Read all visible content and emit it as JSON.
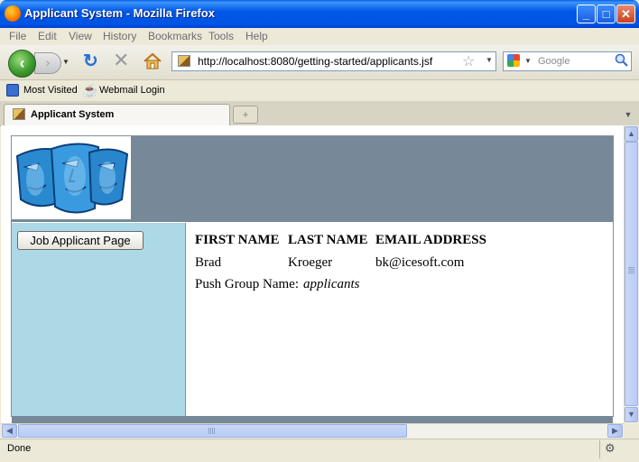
{
  "window": {
    "title": "Applicant System - Mozilla Firefox"
  },
  "menu": [
    "File",
    "Edit",
    "View",
    "History",
    "Bookmarks",
    "Tools",
    "Help"
  ],
  "nav": {
    "url": "http://localhost:8080/getting-started/applicants.jsf",
    "search_placeholder": "Google"
  },
  "bookmarks": [
    {
      "label": "Most Visited"
    },
    {
      "label": "Webmail Login"
    }
  ],
  "tabs": [
    {
      "label": "Applicant System"
    }
  ],
  "page": {
    "job_button_label": "Job Applicant Page",
    "headers": [
      "FIRST NAME",
      "LAST NAME",
      "EMAIL ADDRESS"
    ],
    "row": {
      "first": "Brad",
      "last": "Kroeger",
      "email": "bk@icesoft.com"
    },
    "push_group_label": "Push Group Name:",
    "push_group_value": "applicants"
  },
  "status": {
    "text": "Done"
  },
  "colors": {
    "header_band": "#778899",
    "sidebar": "#add8e6",
    "titlebar": "#0054e3"
  }
}
